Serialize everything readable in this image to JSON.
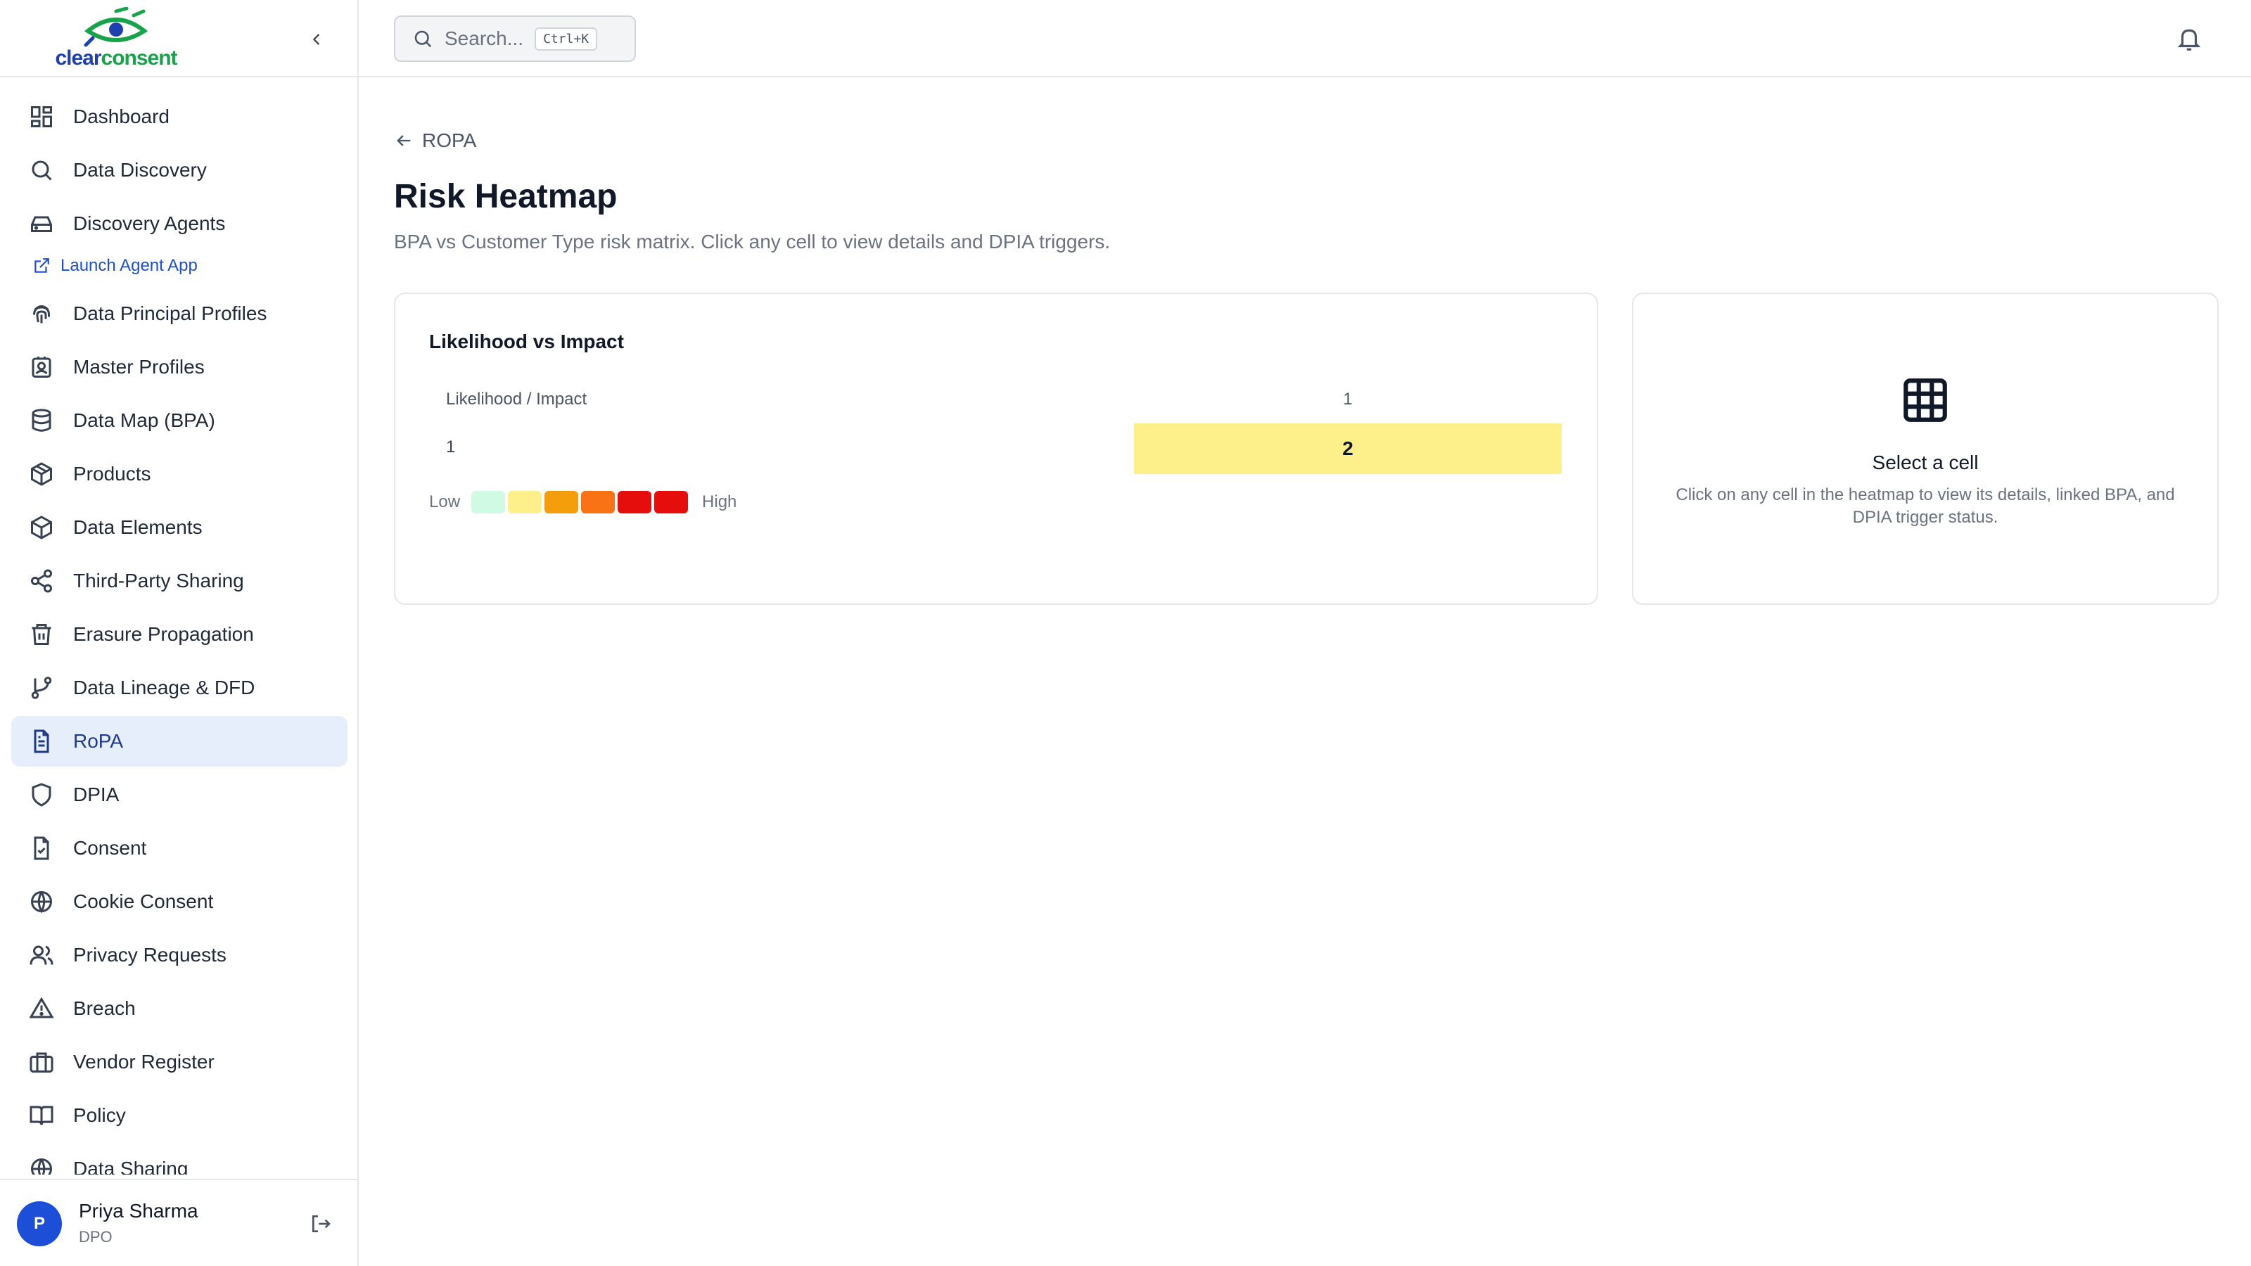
{
  "brand": {
    "part1": "clear",
    "part2": "consent",
    "accent": "#1e40af",
    "green": "#16a34a"
  },
  "sidebar": {
    "items": [
      {
        "label": "Dashboard",
        "icon": "dashboard-icon"
      },
      {
        "label": "Data Discovery",
        "icon": "search-icon"
      },
      {
        "label": "Discovery Agents",
        "icon": "hard-drive-icon"
      },
      {
        "label": "Data Principal Profiles",
        "icon": "fingerprint-icon"
      },
      {
        "label": "Master Profiles",
        "icon": "contact-card-icon"
      },
      {
        "label": "Data Map (BPA)",
        "icon": "database-icon"
      },
      {
        "label": "Products",
        "icon": "package-icon"
      },
      {
        "label": "Data Elements",
        "icon": "cube-icon"
      },
      {
        "label": "Third-Party Sharing",
        "icon": "share-icon"
      },
      {
        "label": "Erasure Propagation",
        "icon": "trash-icon"
      },
      {
        "label": "Data Lineage & DFD",
        "icon": "git-branch-icon"
      },
      {
        "label": "RoPA",
        "icon": "file-text-icon"
      },
      {
        "label": "DPIA",
        "icon": "shield-icon"
      },
      {
        "label": "Consent",
        "icon": "file-check-icon"
      },
      {
        "label": "Cookie Consent",
        "icon": "globe-icon"
      },
      {
        "label": "Privacy Requests",
        "icon": "users-icon"
      },
      {
        "label": "Breach",
        "icon": "alert-triangle-icon"
      },
      {
        "label": "Vendor Register",
        "icon": "briefcase-icon"
      },
      {
        "label": "Policy",
        "icon": "book-icon"
      },
      {
        "label": "Data Sharing",
        "icon": "globe-icon"
      }
    ],
    "launch_agent": "Launch Agent App",
    "active_color": "#e6edfb"
  },
  "user": {
    "initial": "P",
    "name": "Priya Sharma",
    "role": "DPO"
  },
  "search": {
    "placeholder": "Search...",
    "shortcut": "Ctrl+K"
  },
  "page": {
    "back_label": "ROPA",
    "title": "Risk Heatmap",
    "subtitle": "BPA vs Customer Type risk matrix. Click any cell to view details and DPIA triggers."
  },
  "heatmap": {
    "title": "Likelihood vs Impact",
    "corner_label": "Likelihood / Impact",
    "columns": [
      "1"
    ],
    "rows": [
      {
        "label": "1",
        "cells": [
          "2"
        ]
      }
    ],
    "legend_low": "Low",
    "legend_high": "High",
    "legend_colors": [
      "#d1fae5",
      "#fdf08a",
      "#f59e0b",
      "#f97316",
      "#e60d0d",
      "#e60d0d"
    ],
    "cell_color": "#fdf08a"
  },
  "detail": {
    "title": "Select a cell",
    "description": "Click on any cell in the heatmap to view its details, linked BPA, and DPIA trigger status."
  }
}
